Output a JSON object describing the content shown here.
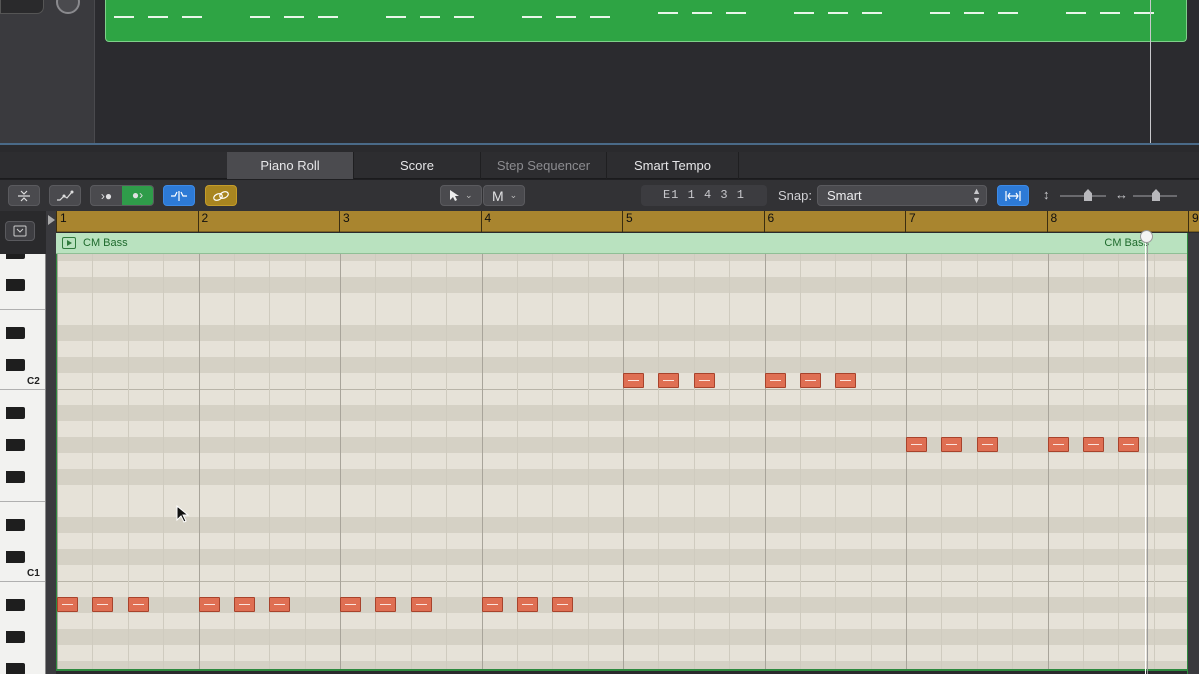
{
  "tabs": [
    {
      "label": "Piano Roll",
      "active": true
    },
    {
      "label": "Score",
      "active": false
    },
    {
      "label": "Step Sequencer",
      "active": false,
      "dimmed": true
    },
    {
      "label": "Smart Tempo",
      "active": false
    }
  ],
  "toolbar": {
    "pointer_tool": "pointer",
    "marquee_tool_label": "M",
    "position_display": "E1  1 4 3 1",
    "snap_label": "Snap:",
    "snap_value": "Smart"
  },
  "ruler": {
    "bars": [
      "1",
      "2",
      "3",
      "4",
      "5",
      "6",
      "7",
      "8",
      "9"
    ]
  },
  "region": {
    "name": "CM Bass",
    "name_end": "CM Bass",
    "color": "#2ea444"
  },
  "keyboard": {
    "labels": [
      "C2",
      "C1"
    ]
  },
  "notes": [
    {
      "pitch": "A#0",
      "bar": 1,
      "beat": 1.0,
      "length": 0.5
    },
    {
      "pitch": "A#0",
      "bar": 1,
      "beat": 2.0,
      "length": 0.5
    },
    {
      "pitch": "A#0",
      "bar": 1,
      "beat": 3.0,
      "length": 0.5
    },
    {
      "pitch": "A#0",
      "bar": 2,
      "beat": 1.0,
      "length": 0.5
    },
    {
      "pitch": "A#0",
      "bar": 2,
      "beat": 2.0,
      "length": 0.5
    },
    {
      "pitch": "A#0",
      "bar": 2,
      "beat": 3.0,
      "length": 0.5
    },
    {
      "pitch": "A#0",
      "bar": 3,
      "beat": 1.0,
      "length": 0.5
    },
    {
      "pitch": "A#0",
      "bar": 3,
      "beat": 2.0,
      "length": 0.5
    },
    {
      "pitch": "A#0",
      "bar": 3,
      "beat": 3.0,
      "length": 0.5
    },
    {
      "pitch": "A#0",
      "bar": 4,
      "beat": 1.0,
      "length": 0.5
    },
    {
      "pitch": "A#0",
      "bar": 4,
      "beat": 2.0,
      "length": 0.5
    },
    {
      "pitch": "A#0",
      "bar": 4,
      "beat": 3.0,
      "length": 0.5
    },
    {
      "pitch": "C2",
      "bar": 5,
      "beat": 1.0,
      "length": 0.5
    },
    {
      "pitch": "C2",
      "bar": 5,
      "beat": 2.0,
      "length": 0.5
    },
    {
      "pitch": "C2",
      "bar": 5,
      "beat": 3.0,
      "length": 0.5
    },
    {
      "pitch": "C2",
      "bar": 6,
      "beat": 1.0,
      "length": 0.5
    },
    {
      "pitch": "C2",
      "bar": 6,
      "beat": 2.0,
      "length": 0.5
    },
    {
      "pitch": "C2",
      "bar": 6,
      "beat": 3.0,
      "length": 0.5
    },
    {
      "pitch": "G#1",
      "bar": 7,
      "beat": 1.0,
      "length": 0.5
    },
    {
      "pitch": "G#1",
      "bar": 7,
      "beat": 2.0,
      "length": 0.5
    },
    {
      "pitch": "G#1",
      "bar": 7,
      "beat": 3.0,
      "length": 0.5
    },
    {
      "pitch": "G#1",
      "bar": 8,
      "beat": 1.0,
      "length": 0.5
    },
    {
      "pitch": "G#1",
      "bar": 8,
      "beat": 2.0,
      "length": 0.5
    },
    {
      "pitch": "G#1",
      "bar": 8,
      "beat": 3.0,
      "length": 0.5
    }
  ],
  "playhead": {
    "bar": 8,
    "beat": 3.9
  },
  "icons": {
    "collapse": "collapse-icon",
    "automation": "automation-icon",
    "midi_in": "midi-in-icon",
    "midi_out": "midi-out-icon",
    "flex": "flex-icon",
    "link": "link-icon",
    "catch": "catch-icon",
    "zoom_vertical": "zoom-vertical-icon",
    "zoom_horizontal": "zoom-horizontal-icon"
  }
}
